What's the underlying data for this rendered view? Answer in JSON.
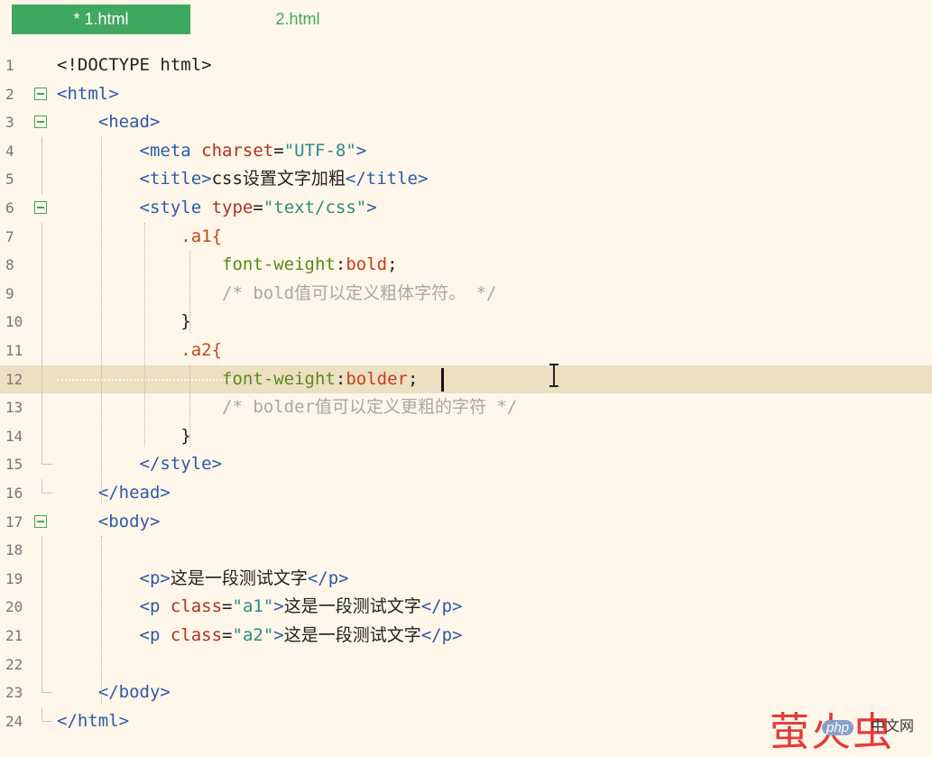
{
  "tabs": [
    {
      "label": "* 1.html",
      "active": true
    },
    {
      "label": "2.html",
      "active": false
    }
  ],
  "lines": [
    {
      "num": "1",
      "fold": "none",
      "parts": [
        [
          "t-txt",
          "<!DOCTYPE html>"
        ]
      ]
    },
    {
      "num": "2",
      "fold": "box",
      "parts": [
        [
          "t-tag",
          "<html>"
        ]
      ]
    },
    {
      "num": "3",
      "fold": "box",
      "parts": [
        [
          "t-txt",
          "    "
        ],
        [
          "t-tag",
          "<head>"
        ]
      ]
    },
    {
      "num": "4",
      "fold": "line",
      "parts": [
        [
          "t-txt",
          "        "
        ],
        [
          "t-tag",
          "<meta "
        ],
        [
          "t-attr",
          "charset"
        ],
        [
          "t-txt",
          "="
        ],
        [
          "t-str",
          "\"UTF-8\""
        ],
        [
          "t-tag",
          ">"
        ]
      ]
    },
    {
      "num": "5",
      "fold": "line",
      "parts": [
        [
          "t-txt",
          "        "
        ],
        [
          "t-tag",
          "<title>"
        ],
        [
          "t-txt",
          "css设置文字加粗"
        ],
        [
          "t-tag",
          "</title>"
        ]
      ]
    },
    {
      "num": "6",
      "fold": "box",
      "parts": [
        [
          "t-txt",
          "        "
        ],
        [
          "t-tag",
          "<style "
        ],
        [
          "t-attr",
          "type"
        ],
        [
          "t-txt",
          "="
        ],
        [
          "t-str",
          "\"text/css\""
        ],
        [
          "t-tag",
          ">"
        ]
      ]
    },
    {
      "num": "7",
      "fold": "line",
      "parts": [
        [
          "t-txt",
          "            "
        ],
        [
          "t-sel",
          ".a1{"
        ]
      ]
    },
    {
      "num": "8",
      "fold": "line",
      "parts": [
        [
          "t-txt",
          "                "
        ],
        [
          "t-prop",
          "font-weight"
        ],
        [
          "t-txt",
          ":"
        ],
        [
          "t-val",
          "bold"
        ],
        [
          "t-txt",
          ";"
        ]
      ]
    },
    {
      "num": "9",
      "fold": "line",
      "parts": [
        [
          "t-txt",
          "                "
        ],
        [
          "t-com",
          "/* bold值可以定义粗体字符。 */"
        ]
      ]
    },
    {
      "num": "10",
      "fold": "line",
      "parts": [
        [
          "t-txt",
          "            "
        ],
        [
          "t-txt",
          "}"
        ]
      ]
    },
    {
      "num": "11",
      "fold": "line",
      "parts": [
        [
          "t-txt",
          "            "
        ],
        [
          "t-sel",
          ".a2{"
        ]
      ]
    },
    {
      "num": "12",
      "fold": "line",
      "active": true,
      "parts": [
        [
          "t-txt",
          "                "
        ],
        [
          "t-prop",
          "font-weight"
        ],
        [
          "t-txt",
          ":"
        ],
        [
          "t-val",
          "bolder"
        ],
        [
          "t-txt",
          ";"
        ]
      ]
    },
    {
      "num": "13",
      "fold": "line",
      "parts": [
        [
          "t-txt",
          "                "
        ],
        [
          "t-com",
          "/* bolder值可以定义更粗的字符 */"
        ]
      ]
    },
    {
      "num": "14",
      "fold": "line",
      "parts": [
        [
          "t-txt",
          "            "
        ],
        [
          "t-txt",
          "}"
        ]
      ]
    },
    {
      "num": "15",
      "fold": "tee",
      "parts": [
        [
          "t-txt",
          "        "
        ],
        [
          "t-tag",
          "</style>"
        ]
      ]
    },
    {
      "num": "16",
      "fold": "tee",
      "parts": [
        [
          "t-txt",
          "    "
        ],
        [
          "t-tag",
          "</head>"
        ]
      ]
    },
    {
      "num": "17",
      "fold": "box",
      "parts": [
        [
          "t-txt",
          "    "
        ],
        [
          "t-tag",
          "<body>"
        ]
      ]
    },
    {
      "num": "18",
      "fold": "line",
      "parts": []
    },
    {
      "num": "19",
      "fold": "line",
      "parts": [
        [
          "t-txt",
          "        "
        ],
        [
          "t-tag",
          "<p>"
        ],
        [
          "t-txt",
          "这是一段测试文字"
        ],
        [
          "t-tag",
          "</p>"
        ]
      ]
    },
    {
      "num": "20",
      "fold": "line",
      "parts": [
        [
          "t-txt",
          "        "
        ],
        [
          "t-tag",
          "<p "
        ],
        [
          "t-attr",
          "class"
        ],
        [
          "t-txt",
          "="
        ],
        [
          "t-str",
          "\"a1\""
        ],
        [
          "t-tag",
          ">"
        ],
        [
          "t-txt",
          "这是一段测试文字"
        ],
        [
          "t-tag",
          "</p>"
        ]
      ]
    },
    {
      "num": "21",
      "fold": "line",
      "parts": [
        [
          "t-txt",
          "        "
        ],
        [
          "t-tag",
          "<p "
        ],
        [
          "t-attr",
          "class"
        ],
        [
          "t-txt",
          "="
        ],
        [
          "t-str",
          "\"a2\""
        ],
        [
          "t-tag",
          ">"
        ],
        [
          "t-txt",
          "这是一段测试文字"
        ],
        [
          "t-tag",
          "</p>"
        ]
      ]
    },
    {
      "num": "22",
      "fold": "line",
      "parts": []
    },
    {
      "num": "23",
      "fold": "tee",
      "parts": [
        [
          "t-txt",
          "    "
        ],
        [
          "t-tag",
          "</body>"
        ]
      ]
    },
    {
      "num": "24",
      "fold": "tee",
      "parts": [
        [
          "t-tag",
          "</html>"
        ]
      ]
    }
  ],
  "watermark": {
    "main": "萤火虫",
    "badge": "php",
    "badge_suffix": "中文网"
  },
  "colors": {
    "accent": "#3fa860",
    "background": "#fdf6e9",
    "active_line": "#ecdfc2"
  }
}
